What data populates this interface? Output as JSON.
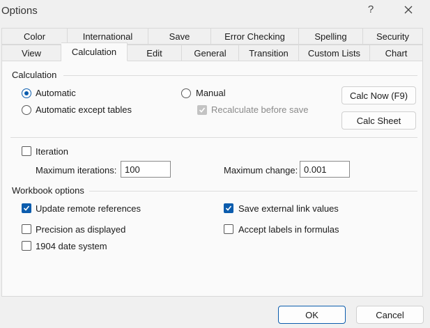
{
  "dialog": {
    "title": "Options",
    "help": "?",
    "close_icon": "close-icon"
  },
  "tabs": {
    "row1": [
      "Color",
      "International",
      "Save",
      "Error Checking",
      "Spelling",
      "Security"
    ],
    "row2": [
      "View",
      "Calculation",
      "Edit",
      "General",
      "Transition",
      "Custom Lists",
      "Chart"
    ],
    "active": "Calculation"
  },
  "calculation": {
    "section": "Calculation",
    "automatic": "Automatic",
    "automatic_except_tables": "Automatic except tables",
    "manual": "Manual",
    "recalculate_before_save": "Recalculate before save",
    "calc_now": "Calc Now (F9)",
    "calc_sheet": "Calc Sheet",
    "selected": "Automatic"
  },
  "iteration": {
    "label": "Iteration",
    "checked": false,
    "max_iterations_label": "Maximum iterations:",
    "max_iterations_value": "100",
    "max_change_label": "Maximum change:",
    "max_change_value": "0.001"
  },
  "workbook": {
    "section": "Workbook options",
    "update_remote_references": "Update remote references",
    "precision_as_displayed": "Precision as displayed",
    "date_system_1904": "1904 date system",
    "save_external_link_values": "Save external link values",
    "accept_labels_in_formulas": "Accept labels in formulas"
  },
  "footer": {
    "ok": "OK",
    "cancel": "Cancel"
  },
  "colors": {
    "accent": "#0b5cad",
    "panel": "#fafafa",
    "background": "#f0f0f0"
  }
}
